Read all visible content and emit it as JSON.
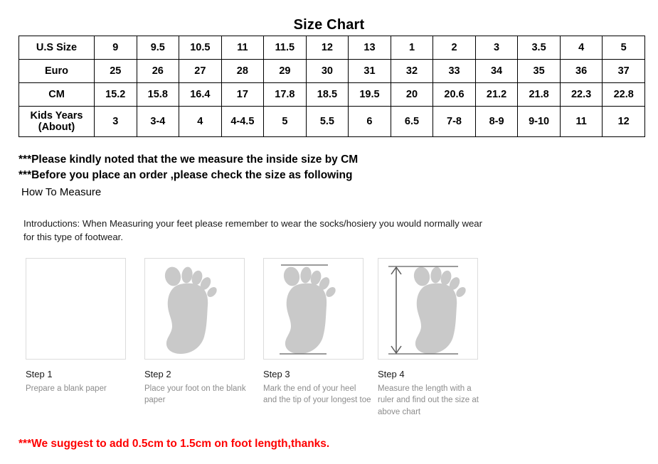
{
  "title": "Size Chart",
  "table": {
    "rows": [
      {
        "header": "U.S Size",
        "values": [
          "9",
          "9.5",
          "10.5",
          "11",
          "11.5",
          "12",
          "13",
          "1",
          "2",
          "3",
          "3.5",
          "4",
          "5"
        ]
      },
      {
        "header": "Euro",
        "values": [
          "25",
          "26",
          "27",
          "28",
          "29",
          "30",
          "31",
          "32",
          "33",
          "34",
          "35",
          "36",
          "37"
        ]
      },
      {
        "header": "CM",
        "values": [
          "15.2",
          "15.8",
          "16.4",
          "17",
          "17.8",
          "18.5",
          "19.5",
          "20",
          "20.6",
          "21.2",
          "21.8",
          "22.3",
          "22.8"
        ]
      },
      {
        "header": "Kids Years (About)",
        "header_line1": "Kids Years",
        "header_line2": "(About)",
        "values": [
          "3",
          "3-4",
          "4",
          "4-4.5",
          "5",
          "5.5",
          "6",
          "6.5",
          "7-8",
          "8-9",
          "9-10",
          "11",
          "12"
        ]
      }
    ]
  },
  "notes": {
    "line1": "***Please kindly noted that the we measure the inside size by CM",
    "line2": "***Before you place an order ,please check the size as following",
    "how_to_measure": "How To Measure",
    "introduction": "Introductions: When Measuring your feet please remember to wear the socks/hosiery you would normally wear for this type of footwear."
  },
  "steps": [
    {
      "title": "Step 1",
      "description": "Prepare a blank paper",
      "illustration": "blank-paper"
    },
    {
      "title": "Step 2",
      "description": "Place your foot on the blank paper",
      "illustration": "foot-outline"
    },
    {
      "title": "Step 3",
      "description": "Mark the end of your heel and the tip of your longest toe",
      "illustration": "foot-with-marks"
    },
    {
      "title": "Step 4",
      "description": "Measure the length with a ruler and find out the size at above chart",
      "illustration": "foot-with-measure-arrow"
    }
  ],
  "bottom_note": "***We suggest to add 0.5cm to 1.5cm on foot length,thanks.",
  "colors": {
    "foot_gray": "#c9c9c9",
    "box_border": "#dcdcdc",
    "mark_line": "#7a7a7a",
    "red_note": "#fe0000",
    "table_border": "#000000"
  }
}
